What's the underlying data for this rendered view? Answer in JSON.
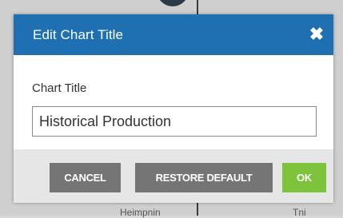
{
  "dialog": {
    "title": "Edit Chart Title",
    "close_icon": "close-icon",
    "field_label": "Chart Title",
    "field_value": "Historical Production",
    "buttons": {
      "cancel": "CANCEL",
      "restore_default": "RESTORE DEFAULT",
      "ok": "OK"
    }
  },
  "background": {
    "left_text": "Heimpnin",
    "right_text": "Tni"
  },
  "colors": {
    "header": "#1f6fb3",
    "secondary_button": "#757575",
    "primary_button": "#7dc33c",
    "footer": "#e6e6e6"
  }
}
